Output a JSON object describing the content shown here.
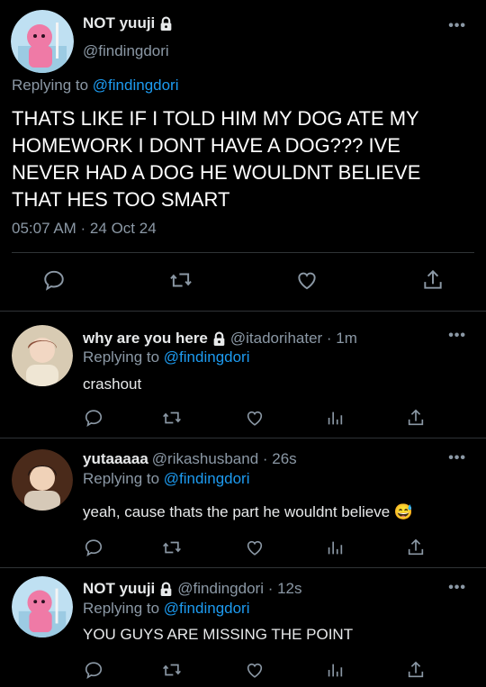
{
  "main_tweet": {
    "display_name": "NOT yuuji",
    "handle": "@findingdori",
    "replying_prefix": "Replying to",
    "replying_handle": "@findingdori",
    "text": "THATS LIKE IF I TOLD HIM MY DOG ATE MY HOMEWORK I DONT HAVE A DOG??? IVE NEVER HAD A DOG HE WOULDNT BELIEVE THAT HES TOO SMART",
    "timestamp": "05:07 AM · 24 Oct 24",
    "more": "•••"
  },
  "replies": [
    {
      "display_name": "why are you here",
      "handle": "@itadorihater · 1m",
      "replying_prefix": "Replying to",
      "replying_handle": "@findingdori",
      "text": "crashout",
      "more": "•••"
    },
    {
      "display_name": "yutaaaaa",
      "handle": "@rikashusband · 26s",
      "replying_prefix": "Replying to",
      "replying_handle": "@findingdori",
      "text": "yeah, cause thats the part he wouldnt believe 😅",
      "more": "•••"
    },
    {
      "display_name": "NOT yuuji",
      "handle": "@findingdori · 12s",
      "replying_prefix": "Replying to",
      "replying_handle": "@findingdori",
      "text": "YOU GUYS ARE MISSING THE POINT",
      "more": "•••"
    }
  ],
  "icons": [
    "lock-icon",
    "reply-icon",
    "retweet-icon",
    "like-icon",
    "views-icon",
    "share-icon",
    "more-icon"
  ],
  "colors": {
    "background": "#000000",
    "text": "#e7e9ea",
    "secondary": "#8b98a5",
    "link": "#1d9bf0",
    "divider": "#2f3336"
  }
}
